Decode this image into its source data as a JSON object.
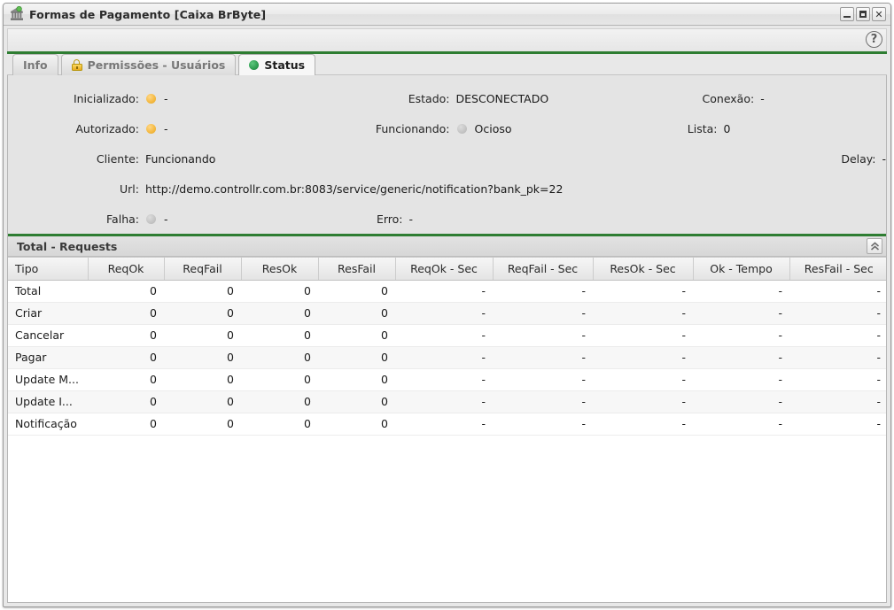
{
  "window": {
    "title": "Formas de Pagamento [Caixa BrByte]",
    "icon": "bank-building-icon",
    "buttons": {
      "minimize": "minimize-icon",
      "maximize": "maximize-icon",
      "close": "✕"
    }
  },
  "toolbar": {
    "help_label": "?"
  },
  "tabs": [
    {
      "label": "Info",
      "icon": null,
      "active": false
    },
    {
      "label": "Permissões - Usuários",
      "icon": "lock-icon",
      "active": false
    },
    {
      "label": "Status",
      "icon": "status-dot-green",
      "active": true
    }
  ],
  "status_info": {
    "col1": [
      {
        "label": "Inicializado:",
        "bullet": "amber",
        "value": "-"
      },
      {
        "label": "Autorizado:",
        "bullet": "amber",
        "value": "-"
      },
      {
        "label": "Cliente:",
        "bullet": null,
        "value": "Funcionando"
      },
      {
        "label": "Url:",
        "bullet": null,
        "value": "http://demo.controllr.com.br:8083/service/generic/notification?bank_pk=22"
      },
      {
        "label": "Falha:",
        "bullet": "grey",
        "value": "-"
      }
    ],
    "col2": [
      {
        "label": "Estado:",
        "bullet": null,
        "value": "DESCONECTADO"
      },
      {
        "label": "Funcionando:",
        "bullet": "grey",
        "value": "Ocioso"
      },
      {
        "label": "Erro:",
        "bullet": null,
        "value": "-"
      }
    ],
    "col3": [
      {
        "label": "Conexão:",
        "bullet": null,
        "value": "-"
      },
      {
        "label": "Lista:",
        "bullet": null,
        "value": "0"
      },
      {
        "label": "Delay:",
        "bullet": null,
        "value": "-"
      }
    ]
  },
  "requests_section": {
    "title": "Total - Requests",
    "collapse_icon": "chevron-up-double-icon",
    "columns": [
      "Tipo",
      "ReqOk",
      "ReqFail",
      "ResOk",
      "ResFail",
      "ReqOk - Sec",
      "ReqFail - Sec",
      "ResOk - Sec",
      "Ok - Tempo",
      "ResFail - Sec"
    ],
    "rows": [
      {
        "tipo": "Total",
        "reqok": "0",
        "reqfail": "0",
        "resok": "0",
        "resfail": "0",
        "reqok_sec": "-",
        "reqfail_sec": "-",
        "resok_sec": "-",
        "ok_tempo": "-",
        "resfail_sec": "-"
      },
      {
        "tipo": "Criar",
        "reqok": "0",
        "reqfail": "0",
        "resok": "0",
        "resfail": "0",
        "reqok_sec": "-",
        "reqfail_sec": "-",
        "resok_sec": "-",
        "ok_tempo": "-",
        "resfail_sec": "-"
      },
      {
        "tipo": "Cancelar",
        "reqok": "0",
        "reqfail": "0",
        "resok": "0",
        "resfail": "0",
        "reqok_sec": "-",
        "reqfail_sec": "-",
        "resok_sec": "-",
        "ok_tempo": "-",
        "resfail_sec": "-"
      },
      {
        "tipo": "Pagar",
        "reqok": "0",
        "reqfail": "0",
        "resok": "0",
        "resfail": "0",
        "reqok_sec": "-",
        "reqfail_sec": "-",
        "resok_sec": "-",
        "ok_tempo": "-",
        "resfail_sec": "-"
      },
      {
        "tipo": "Update M...",
        "reqok": "0",
        "reqfail": "0",
        "resok": "0",
        "resfail": "0",
        "reqok_sec": "-",
        "reqfail_sec": "-",
        "resok_sec": "-",
        "ok_tempo": "-",
        "resfail_sec": "-"
      },
      {
        "tipo": "Update I...",
        "reqok": "0",
        "reqfail": "0",
        "resok": "0",
        "resfail": "0",
        "reqok_sec": "-",
        "reqfail_sec": "-",
        "resok_sec": "-",
        "ok_tempo": "-",
        "resfail_sec": "-"
      },
      {
        "tipo": "Notificação",
        "reqok": "0",
        "reqfail": "0",
        "resok": "0",
        "resfail": "0",
        "reqok_sec": "-",
        "reqfail_sec": "-",
        "resok_sec": "-",
        "ok_tempo": "-",
        "resfail_sec": "-"
      }
    ]
  },
  "colors": {
    "accent_green": "#2e7d32",
    "status_ok": "#2f9e52",
    "status_warn": "#f5bb45",
    "status_idle": "#c6c6c6"
  }
}
